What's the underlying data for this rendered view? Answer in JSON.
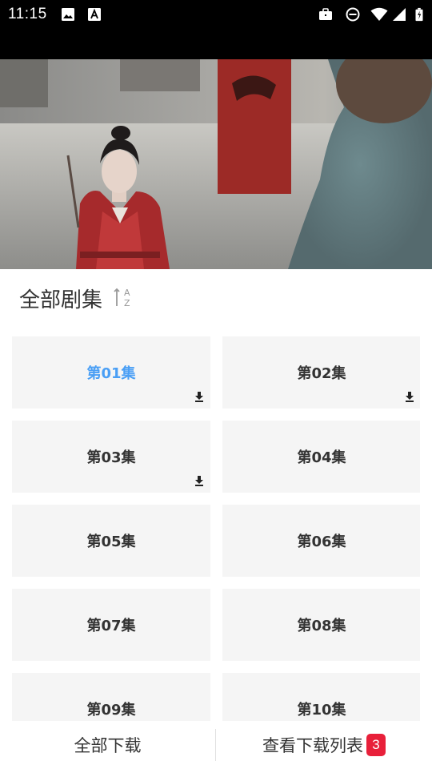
{
  "status_bar": {
    "time": "11:15",
    "icons": [
      "image-icon",
      "font-icon",
      "briefcase-icon",
      "do-not-disturb-icon",
      "wifi-icon",
      "cellular-signal-icon",
      "battery-charging-icon"
    ]
  },
  "episodes": {
    "title": "全部剧集",
    "sort_icon": "sort-az-icon",
    "items": [
      {
        "label": "第01集",
        "active": true,
        "downloaded": true
      },
      {
        "label": "第02集",
        "active": false,
        "downloaded": true
      },
      {
        "label": "第03集",
        "active": false,
        "downloaded": true
      },
      {
        "label": "第04集",
        "active": false,
        "downloaded": false
      },
      {
        "label": "第05集",
        "active": false,
        "downloaded": false
      },
      {
        "label": "第06集",
        "active": false,
        "downloaded": false
      },
      {
        "label": "第07集",
        "active": false,
        "downloaded": false
      },
      {
        "label": "第08集",
        "active": false,
        "downloaded": false
      },
      {
        "label": "第09集",
        "active": false,
        "downloaded": false
      },
      {
        "label": "第10集",
        "active": false,
        "downloaded": false
      }
    ]
  },
  "bottom_bar": {
    "download_all": "全部下载",
    "download_list": "查看下载列表",
    "download_count": "3"
  },
  "colors": {
    "active_episode": "#4a9ff5",
    "badge": "#e8203a",
    "tile_background": "#f5f5f5"
  }
}
